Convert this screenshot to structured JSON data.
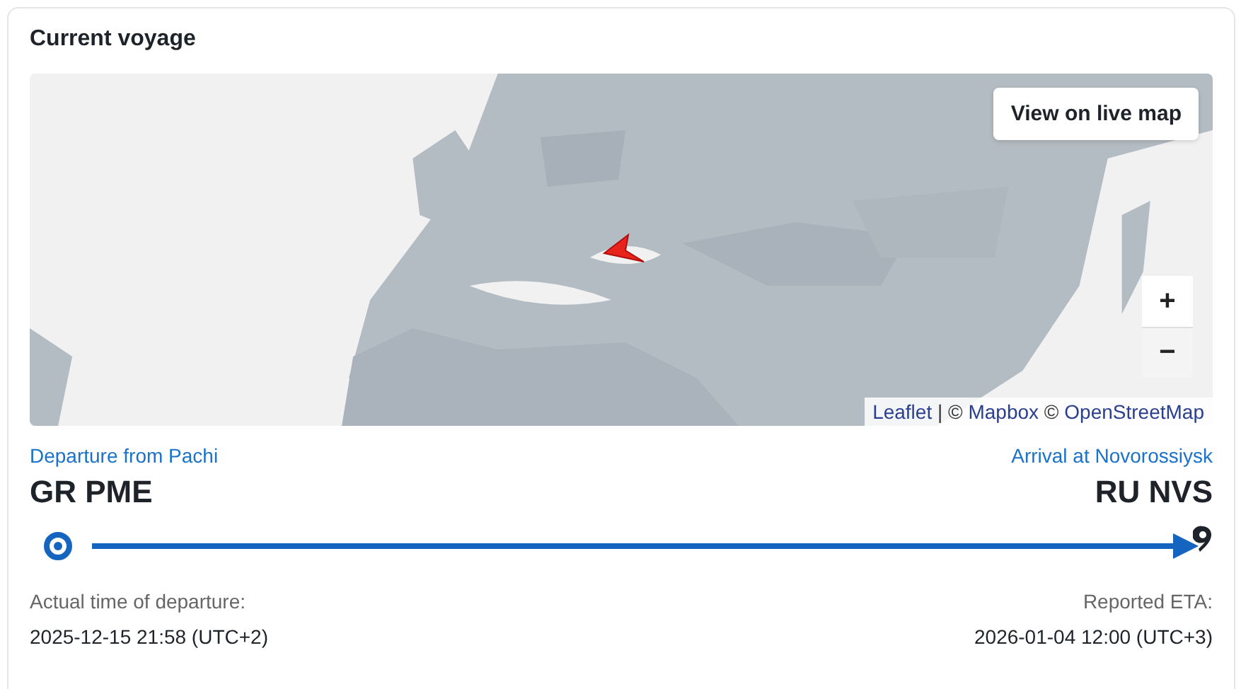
{
  "card": {
    "title": "Current voyage"
  },
  "map": {
    "kind": "picture",
    "live_map_button": "View on live map",
    "zoom_in": "+",
    "zoom_out": "−",
    "attribution": [
      {
        "text": "Leaflet",
        "link": true
      },
      {
        "text": " | © ",
        "link": false
      },
      {
        "text": "Mapbox",
        "link": true
      },
      {
        "text": " © ",
        "link": false
      },
      {
        "text": "OpenStreetMap",
        "link": true
      }
    ]
  },
  "departure": {
    "label": "Departure from Pachi",
    "code": "GR PME",
    "time_label": "Actual time of departure:",
    "time": "2025-12-15 21:58 (UTC+2)"
  },
  "arrival": {
    "label": "Arrival at Novorossiysk",
    "code": "RU NVS",
    "time_label": "Reported ETA:",
    "time": "2026-01-04 12:00 (UTC+3)"
  },
  "progress": {
    "level": 1
  }
}
